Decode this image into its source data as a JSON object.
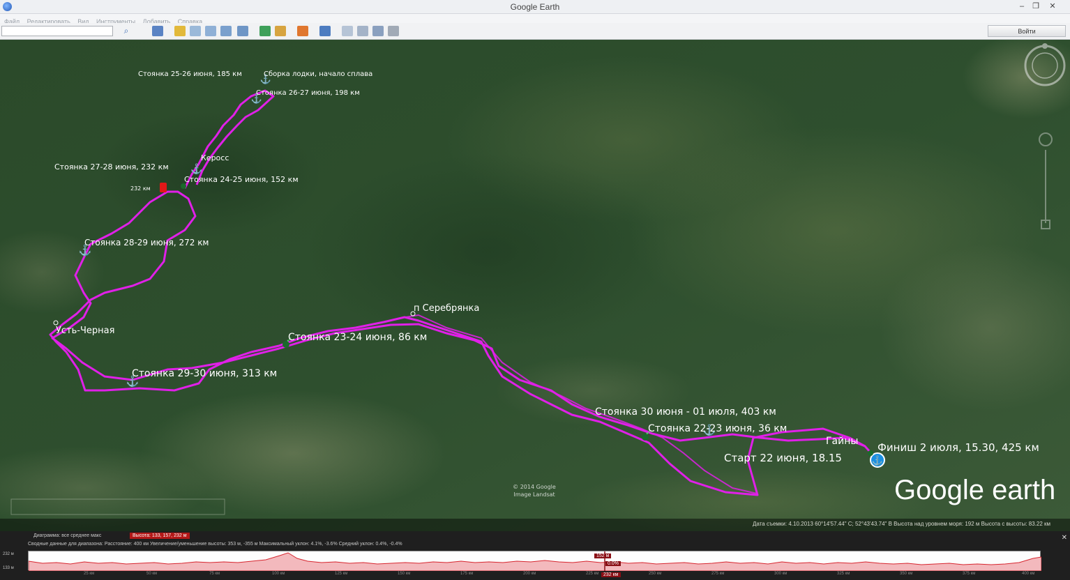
{
  "window": {
    "title": "Google Earth",
    "buttons": [
      "–",
      "❐",
      "✕"
    ]
  },
  "menu": [
    "Файл",
    "Редактировать",
    "Вид",
    "Инструменты",
    "Добавить",
    "Справка"
  ],
  "toolbar": {
    "search_value": "",
    "signin_label": "Войти"
  },
  "map": {
    "labels": {
      "finish": "Финиш 2 июля, 15.30, 425 км",
      "start": "Старт 22 июня, 18.15",
      "gainy": "Гайны",
      "stop_22_23": "Стоянка 22-23 июня, 36 км",
      "stop_30_01": "Стоянка 30 июня - 01 июля, 403 км",
      "serebryanka": "п Серебрянка",
      "stop_23_24": "Стоянка 23-24 июня, 86 км",
      "stop_29_30": "Стоянка 29-30 июня, 313 км",
      "ust_chernaya": "Усть-Черная",
      "stop_28_29": "Стоянка 28-29 июня, 272 км",
      "stop_24_25": "Стоянка 24-25 июня, 152 км",
      "stop_27_28": "Стоянка 27-28 июня, 232 км",
      "kerass": "Керосс",
      "stop_26_27": "Стоянка 26-27 июня, 198 км",
      "stop_25_26": "Стоянка 25-26 июня, 185 км",
      "boat_assembly": "Сборка лодки, начало сплава",
      "marker_232": "232 км"
    },
    "copyright": [
      "© 2014 Google",
      "Image Landsat"
    ],
    "logo": "Google earth",
    "route_color": "#e020e8"
  },
  "status": {
    "text": "Дата съемки: 4.10.2013     60°14'57.44\" С; 52°43'43.74\" В  Высота над уровнем моря:  192 м     Высота с высоты:  83.22 км"
  },
  "elevation": {
    "header_left": "Диаграмма: все   среднее   макс",
    "highlight": "Высота: 133, 157, 232 м",
    "summary": "Сводные данные для диапазона:  Расстояние: 400 км   Увеличение/уменьшение высоты: 353 м, -355 м   Максимальный уклон: 4.1%, -3.6%   Средний уклон: 0.4%, -0.4%",
    "y_top": "232 м",
    "y_bottom": "133 м",
    "cursor_value": "152 м",
    "cursor_pct": "0.0%",
    "cursor_km": "232 км",
    "x_ticks": [
      "25 км",
      "50 км",
      "75 км",
      "100 км",
      "125 км",
      "150 км",
      "175 км",
      "200 км",
      "225 км",
      "250 км",
      "275 км",
      "300 км",
      "325 км",
      "350 км",
      "375 км",
      "400 км"
    ]
  }
}
